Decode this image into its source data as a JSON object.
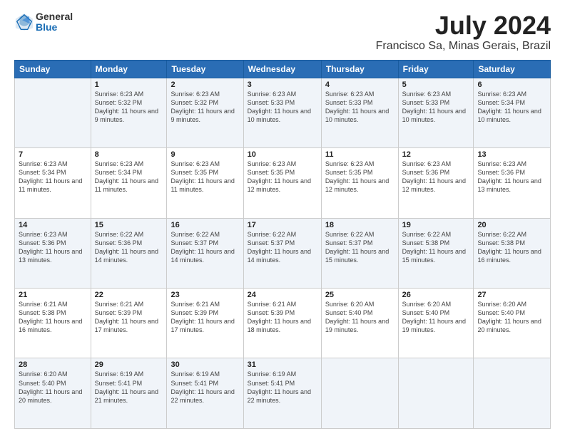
{
  "logo": {
    "general": "General",
    "blue": "Blue"
  },
  "title": "July 2024",
  "location": "Francisco Sa, Minas Gerais, Brazil",
  "days_of_week": [
    "Sunday",
    "Monday",
    "Tuesday",
    "Wednesday",
    "Thursday",
    "Friday",
    "Saturday"
  ],
  "weeks": [
    [
      {
        "day": "",
        "sunrise": "",
        "sunset": "",
        "daylight": ""
      },
      {
        "day": "1",
        "sunrise": "Sunrise: 6:23 AM",
        "sunset": "Sunset: 5:32 PM",
        "daylight": "Daylight: 11 hours and 9 minutes."
      },
      {
        "day": "2",
        "sunrise": "Sunrise: 6:23 AM",
        "sunset": "Sunset: 5:32 PM",
        "daylight": "Daylight: 11 hours and 9 minutes."
      },
      {
        "day": "3",
        "sunrise": "Sunrise: 6:23 AM",
        "sunset": "Sunset: 5:33 PM",
        "daylight": "Daylight: 11 hours and 10 minutes."
      },
      {
        "day": "4",
        "sunrise": "Sunrise: 6:23 AM",
        "sunset": "Sunset: 5:33 PM",
        "daylight": "Daylight: 11 hours and 10 minutes."
      },
      {
        "day": "5",
        "sunrise": "Sunrise: 6:23 AM",
        "sunset": "Sunset: 5:33 PM",
        "daylight": "Daylight: 11 hours and 10 minutes."
      },
      {
        "day": "6",
        "sunrise": "Sunrise: 6:23 AM",
        "sunset": "Sunset: 5:34 PM",
        "daylight": "Daylight: 11 hours and 10 minutes."
      }
    ],
    [
      {
        "day": "7",
        "sunrise": "Sunrise: 6:23 AM",
        "sunset": "Sunset: 5:34 PM",
        "daylight": "Daylight: 11 hours and 11 minutes."
      },
      {
        "day": "8",
        "sunrise": "Sunrise: 6:23 AM",
        "sunset": "Sunset: 5:34 PM",
        "daylight": "Daylight: 11 hours and 11 minutes."
      },
      {
        "day": "9",
        "sunrise": "Sunrise: 6:23 AM",
        "sunset": "Sunset: 5:35 PM",
        "daylight": "Daylight: 11 hours and 11 minutes."
      },
      {
        "day": "10",
        "sunrise": "Sunrise: 6:23 AM",
        "sunset": "Sunset: 5:35 PM",
        "daylight": "Daylight: 11 hours and 12 minutes."
      },
      {
        "day": "11",
        "sunrise": "Sunrise: 6:23 AM",
        "sunset": "Sunset: 5:35 PM",
        "daylight": "Daylight: 11 hours and 12 minutes."
      },
      {
        "day": "12",
        "sunrise": "Sunrise: 6:23 AM",
        "sunset": "Sunset: 5:36 PM",
        "daylight": "Daylight: 11 hours and 12 minutes."
      },
      {
        "day": "13",
        "sunrise": "Sunrise: 6:23 AM",
        "sunset": "Sunset: 5:36 PM",
        "daylight": "Daylight: 11 hours and 13 minutes."
      }
    ],
    [
      {
        "day": "14",
        "sunrise": "Sunrise: 6:23 AM",
        "sunset": "Sunset: 5:36 PM",
        "daylight": "Daylight: 11 hours and 13 minutes."
      },
      {
        "day": "15",
        "sunrise": "Sunrise: 6:22 AM",
        "sunset": "Sunset: 5:36 PM",
        "daylight": "Daylight: 11 hours and 14 minutes."
      },
      {
        "day": "16",
        "sunrise": "Sunrise: 6:22 AM",
        "sunset": "Sunset: 5:37 PM",
        "daylight": "Daylight: 11 hours and 14 minutes."
      },
      {
        "day": "17",
        "sunrise": "Sunrise: 6:22 AM",
        "sunset": "Sunset: 5:37 PM",
        "daylight": "Daylight: 11 hours and 14 minutes."
      },
      {
        "day": "18",
        "sunrise": "Sunrise: 6:22 AM",
        "sunset": "Sunset: 5:37 PM",
        "daylight": "Daylight: 11 hours and 15 minutes."
      },
      {
        "day": "19",
        "sunrise": "Sunrise: 6:22 AM",
        "sunset": "Sunset: 5:38 PM",
        "daylight": "Daylight: 11 hours and 15 minutes."
      },
      {
        "day": "20",
        "sunrise": "Sunrise: 6:22 AM",
        "sunset": "Sunset: 5:38 PM",
        "daylight": "Daylight: 11 hours and 16 minutes."
      }
    ],
    [
      {
        "day": "21",
        "sunrise": "Sunrise: 6:21 AM",
        "sunset": "Sunset: 5:38 PM",
        "daylight": "Daylight: 11 hours and 16 minutes."
      },
      {
        "day": "22",
        "sunrise": "Sunrise: 6:21 AM",
        "sunset": "Sunset: 5:39 PM",
        "daylight": "Daylight: 11 hours and 17 minutes."
      },
      {
        "day": "23",
        "sunrise": "Sunrise: 6:21 AM",
        "sunset": "Sunset: 5:39 PM",
        "daylight": "Daylight: 11 hours and 17 minutes."
      },
      {
        "day": "24",
        "sunrise": "Sunrise: 6:21 AM",
        "sunset": "Sunset: 5:39 PM",
        "daylight": "Daylight: 11 hours and 18 minutes."
      },
      {
        "day": "25",
        "sunrise": "Sunrise: 6:20 AM",
        "sunset": "Sunset: 5:40 PM",
        "daylight": "Daylight: 11 hours and 19 minutes."
      },
      {
        "day": "26",
        "sunrise": "Sunrise: 6:20 AM",
        "sunset": "Sunset: 5:40 PM",
        "daylight": "Daylight: 11 hours and 19 minutes."
      },
      {
        "day": "27",
        "sunrise": "Sunrise: 6:20 AM",
        "sunset": "Sunset: 5:40 PM",
        "daylight": "Daylight: 11 hours and 20 minutes."
      }
    ],
    [
      {
        "day": "28",
        "sunrise": "Sunrise: 6:20 AM",
        "sunset": "Sunset: 5:40 PM",
        "daylight": "Daylight: 11 hours and 20 minutes."
      },
      {
        "day": "29",
        "sunrise": "Sunrise: 6:19 AM",
        "sunset": "Sunset: 5:41 PM",
        "daylight": "Daylight: 11 hours and 21 minutes."
      },
      {
        "day": "30",
        "sunrise": "Sunrise: 6:19 AM",
        "sunset": "Sunset: 5:41 PM",
        "daylight": "Daylight: 11 hours and 22 minutes."
      },
      {
        "day": "31",
        "sunrise": "Sunrise: 6:19 AM",
        "sunset": "Sunset: 5:41 PM",
        "daylight": "Daylight: 11 hours and 22 minutes."
      },
      {
        "day": "",
        "sunrise": "",
        "sunset": "",
        "daylight": ""
      },
      {
        "day": "",
        "sunrise": "",
        "sunset": "",
        "daylight": ""
      },
      {
        "day": "",
        "sunrise": "",
        "sunset": "",
        "daylight": ""
      }
    ]
  ]
}
